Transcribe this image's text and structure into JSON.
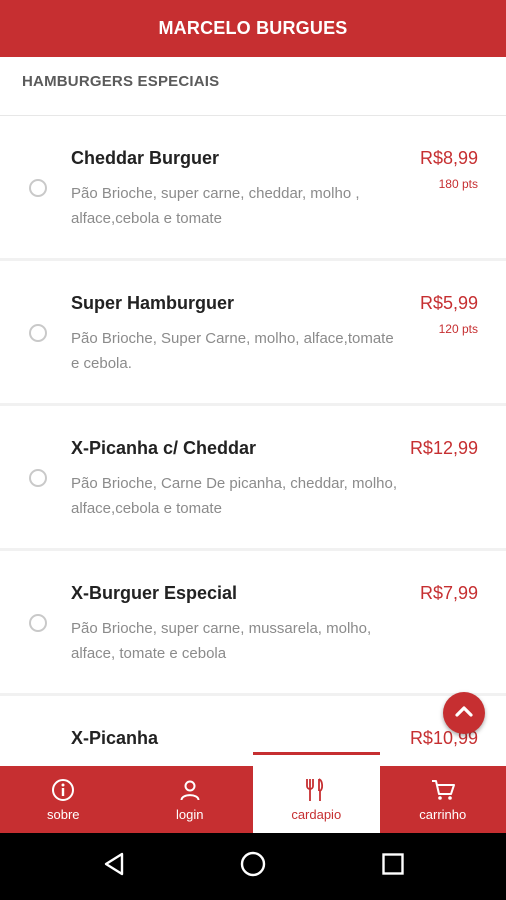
{
  "header": {
    "title": "MARCELO BURGUES"
  },
  "section": {
    "title": "HAMBURGERS ESPECIAIS"
  },
  "items": [
    {
      "name": "Cheddar Burguer",
      "description": "Pão Brioche, super carne, cheddar, molho , alface,cebola e tomate",
      "price": "R$8,99",
      "points": "180 pts"
    },
    {
      "name": "Super Hamburguer",
      "description": "Pão Brioche, Super Carne, molho, alface,tomate e cebola.",
      "price": "R$5,99",
      "points": "120 pts"
    },
    {
      "name": "X-Picanha c/ Cheddar",
      "description": "Pão Brioche, Carne De picanha, cheddar, molho, alface,cebola e tomate",
      "price": "R$12,99",
      "points": ""
    },
    {
      "name": "X-Burguer Especial",
      "description": "Pão Brioche, super carne, mussarela, molho, alface, tomate e cebola",
      "price": "R$7,99",
      "points": ""
    },
    {
      "name": "X-Picanha",
      "description": "",
      "price": "R$10,99",
      "points": ""
    }
  ],
  "nav": {
    "sobre": {
      "label": "sobre",
      "icon": "info-icon"
    },
    "login": {
      "label": "login",
      "icon": "user-icon"
    },
    "cardapio": {
      "label": "cardapio",
      "icon": "cutlery-icon",
      "active": true
    },
    "carrinho": {
      "label": "carrinho",
      "icon": "cart-icon"
    }
  },
  "colors": {
    "brand": "#c62f31",
    "text": "#222222",
    "muted": "#8b8b8b"
  }
}
